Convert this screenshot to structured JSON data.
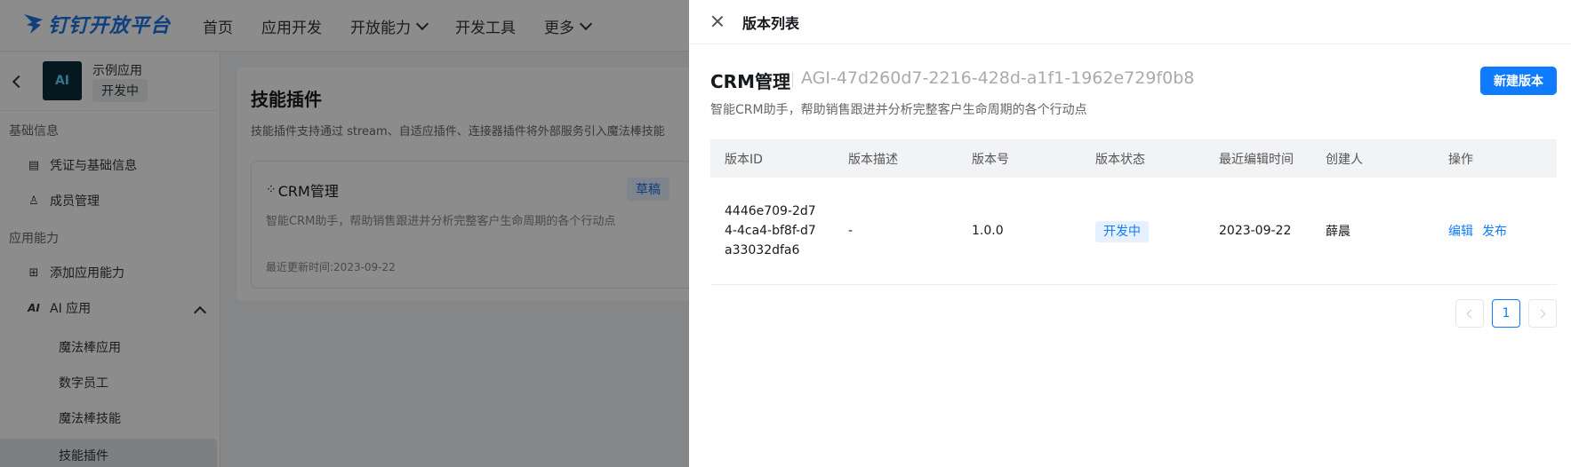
{
  "topbar": {
    "logo_text": "钉钉开放平台",
    "nav": [
      "首页",
      "应用开发",
      "开放能力",
      "开发工具",
      "更多"
    ]
  },
  "sidebar": {
    "app_name": "示例应用",
    "app_status": "开发中",
    "app_avatar_text": "AI",
    "sections": [
      {
        "title": "基础信息",
        "items": [
          "凭证与基础信息",
          "成员管理"
        ]
      },
      {
        "title": "应用能力",
        "items": [
          "添加应用能力",
          "AI 应用"
        ]
      }
    ],
    "sub_items": [
      "魔法棒应用",
      "数字员工",
      "魔法棒技能",
      "技能插件"
    ]
  },
  "main": {
    "title": "技能插件",
    "desc": "技能插件支持通过 stream、自适应插件、连接器插件将外部服务引入魔法棒技能",
    "card": {
      "title": "CRM管理",
      "badge": "草稿",
      "desc": "智能CRM助手，帮助销售跟进并分析完整客户生命周期的各个行动点",
      "updated": "最近更新时间:2023-09-22"
    }
  },
  "drawer": {
    "title": "版本列表",
    "name": "CRM管理",
    "id": "AGI-47d260d7-2216-428d-a1f1-1962e729f0b8",
    "desc": "智能CRM助手，帮助销售跟进并分析完整客户生命周期的各个行动点",
    "new_button": "新建版本",
    "columns": [
      "版本ID",
      "版本描述",
      "版本号",
      "版本状态",
      "最近编辑时间",
      "创建人",
      "操作"
    ],
    "rows": [
      {
        "version_id": "4446e709-2d74-4ca4-bf8f-d7a33032dfa6",
        "description": "-",
        "version": "1.0.0",
        "status": "开发中",
        "edited": "2023-09-22",
        "creator": "薛晨",
        "actions": [
          "编辑",
          "发布"
        ]
      }
    ],
    "pagination": {
      "current": "1"
    }
  },
  "colors": {
    "primary": "#0f7bff",
    "overlay": "rgba(0,0,0,0.45)"
  }
}
